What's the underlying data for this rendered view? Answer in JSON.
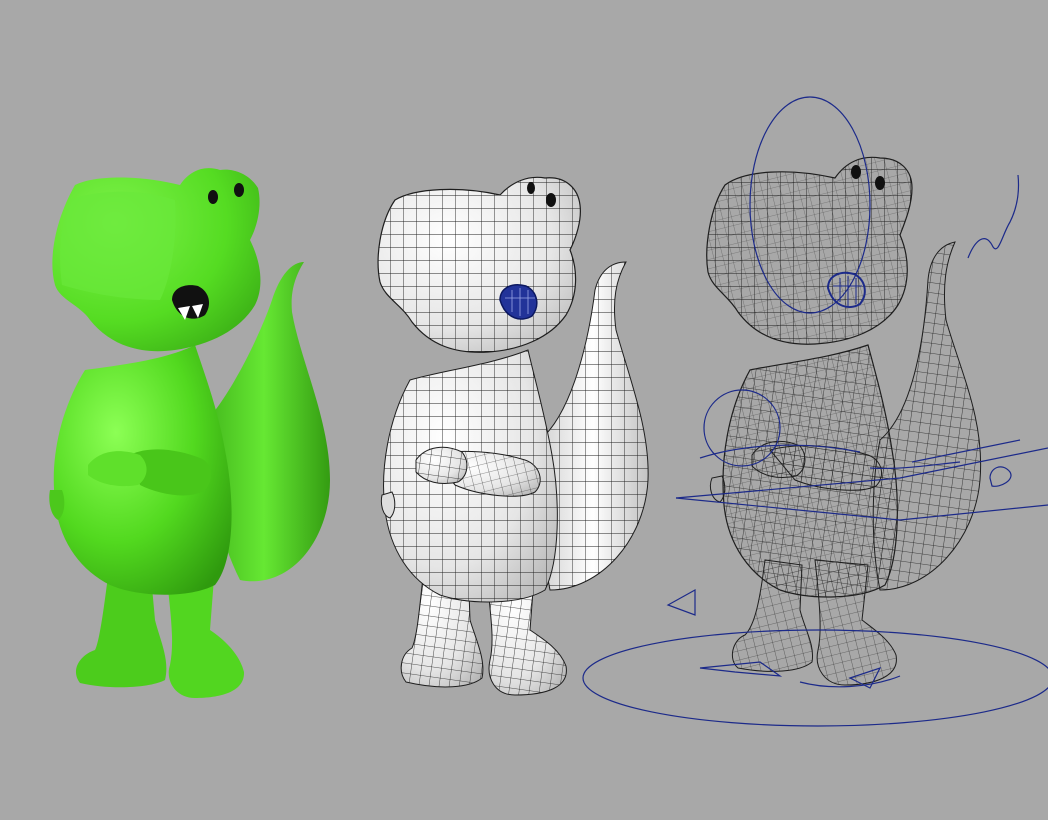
{
  "scene": {
    "background": "#a8a8a8",
    "models": [
      {
        "name": "shaded-dinosaur",
        "render_mode": "smooth-shaded",
        "color": "#5ee02a"
      },
      {
        "name": "wireframe-on-shaded-dinosaur",
        "render_mode": "wireframe-on-shaded",
        "color": "#f2f2f2"
      },
      {
        "name": "rigged-wireframe-dinosaur",
        "render_mode": "wireframe-with-rig-controls",
        "color": "#9a9a9a"
      }
    ],
    "rig_color": "#1c2a8a",
    "wire_color": "#1e1e1e"
  }
}
